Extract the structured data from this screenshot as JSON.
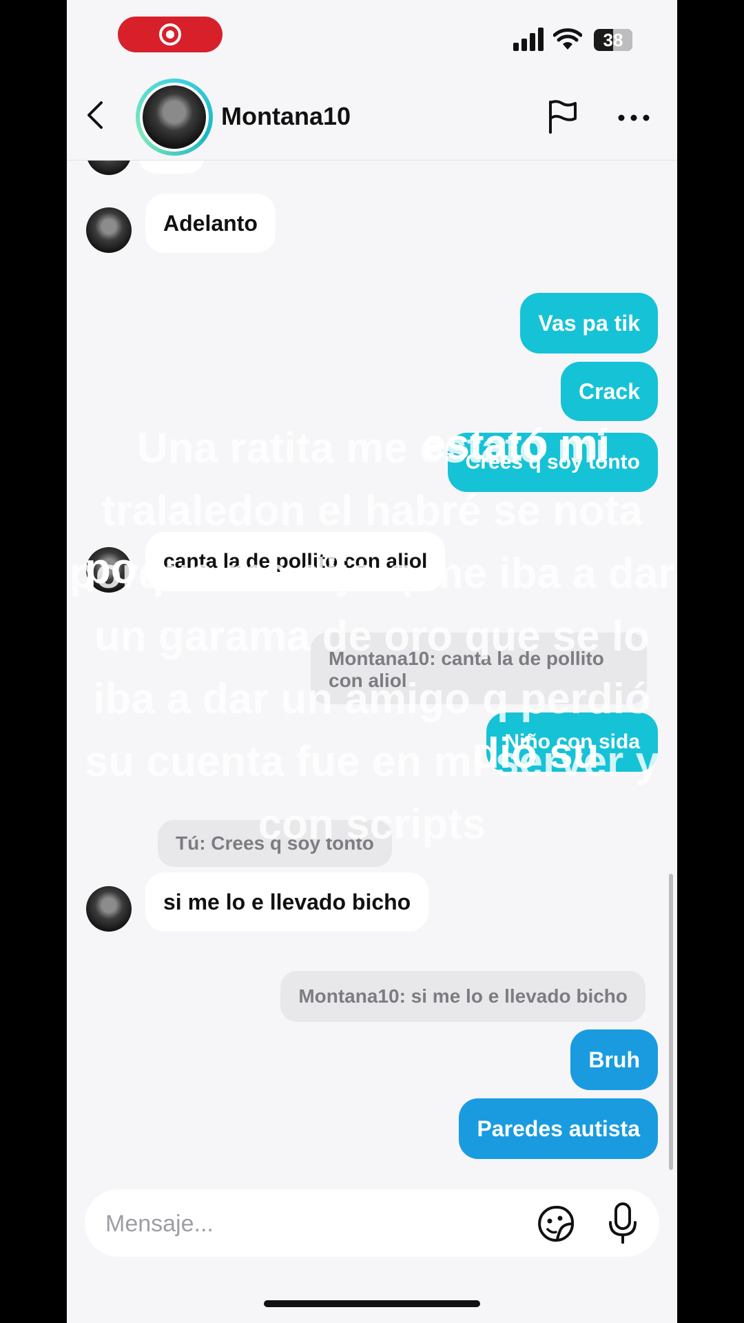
{
  "status_bar": {
    "battery": "38"
  },
  "header": {
    "username": "Montana10"
  },
  "messages": [
    {
      "from": "them",
      "text": "Adelanto"
    },
    {
      "from": "me",
      "text": "Vas pa tik"
    },
    {
      "from": "me",
      "text": "Crack"
    },
    {
      "from": "me",
      "text": "Crees q soy tonto"
    },
    {
      "from": "them",
      "text": "canta la de pollito con aliol"
    },
    {
      "from": "me",
      "quote": "Montana10: canta la de pollito con aliol",
      "text": "Niño con sida"
    },
    {
      "from": "them",
      "quote": "Tú: Crees q soy tonto",
      "text": "si me lo e llevado bicho"
    },
    {
      "from": "me",
      "quote": "Montana10: si me lo e llevado bicho",
      "text": "Bruh"
    },
    {
      "from": "me",
      "text": "Paredes autista"
    }
  ],
  "overlay_caption": "Una ratita me estató mi tralaledon el habré se nota porque me dijo q me iba a dar un garama de oro que se lo iba a dar un amigo q perdió su cuenta fue en mi server y con scripts",
  "overlay_fragments": {
    "a": "estató mi",
    "b": "dió su",
    "c": "po"
  },
  "composer": {
    "placeholder": "Mensaje..."
  },
  "colors": {
    "outgoing_teal": "#16c2d6",
    "outgoing_blue": "#1a9be0",
    "incoming": "#ffffff",
    "record": "#d8202b"
  },
  "icons": [
    "record-icon",
    "signal-icon",
    "wifi-icon",
    "battery-icon",
    "back-icon",
    "flag-icon",
    "more-icon",
    "sticker-icon",
    "mic-icon"
  ]
}
